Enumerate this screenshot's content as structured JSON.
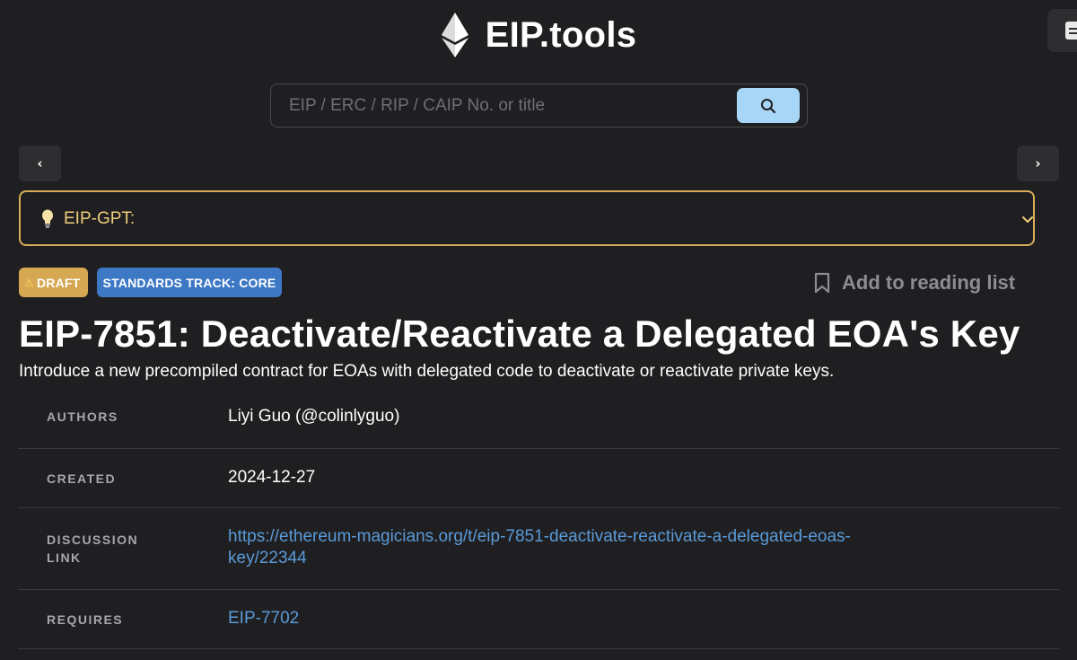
{
  "header": {
    "logo_text": "EIP.tools",
    "logo_icon": "ethereum-icon",
    "corner_icon": "menu-icon"
  },
  "search": {
    "placeholder": "EIP / ERC / RIP / CAIP No. or title",
    "value": "",
    "button_icon": "search-icon"
  },
  "nav": {
    "prev_glyph": "‹",
    "next_glyph": "›"
  },
  "gpt": {
    "label": "EIP-GPT:",
    "icon": "lightbulb-icon"
  },
  "badges": {
    "status": "DRAFT",
    "category": "STANDARDS TRACK: CORE"
  },
  "reading_list": {
    "label": "Add to reading list",
    "icon": "bookmark-icon"
  },
  "eip": {
    "title": "EIP-7851: Deactivate/Reactivate a Delegated EOA's Key",
    "description": "Introduce a new precompiled contract for EOAs with delegated code to deactivate or reactivate private keys."
  },
  "meta": {
    "rows": [
      {
        "label": "AUTHORS",
        "value": "Liyi Guo (@colinlyguo)"
      },
      {
        "label": "CREATED",
        "value": "2024-12-27"
      },
      {
        "label_line1": "DISCUSSION",
        "label_line2": "LINK",
        "value_line1": "https://ethereum-magicians.org/t/eip-7851-deactivate-reactivate-a-delegated-eoas-",
        "value_line2": "key/22344"
      },
      {
        "label": "REQUIRES",
        "value": "EIP-7702"
      }
    ]
  },
  "colors": {
    "background": "#1f1f21",
    "accent_gold": "#d7ad58",
    "accent_blue": "#3d78c5",
    "link": "#5a9ad8",
    "search_button": "#a7d6f6"
  }
}
